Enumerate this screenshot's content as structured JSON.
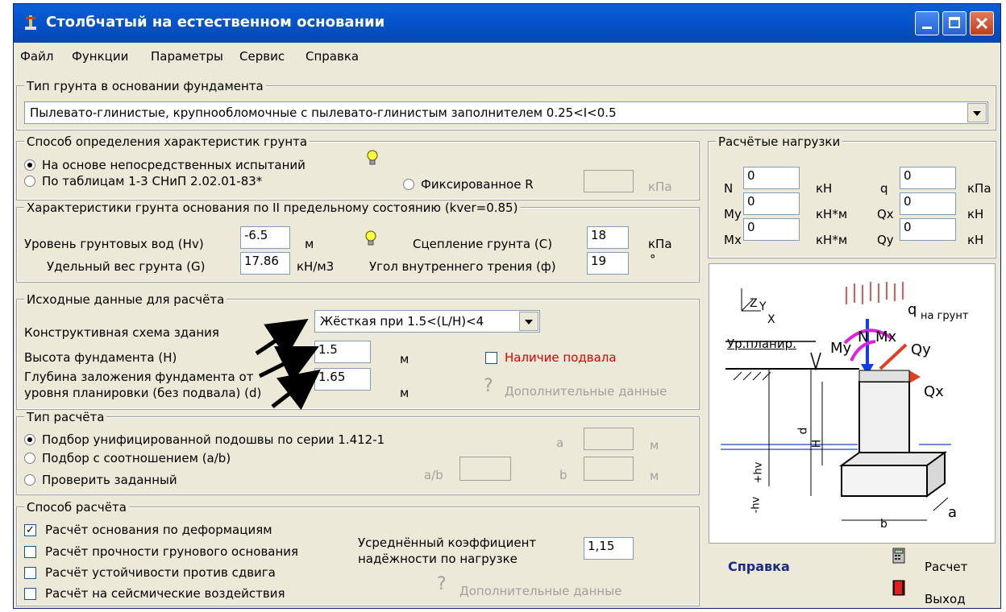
{
  "window": {
    "title": "Столбчатый на естественном основании"
  },
  "menu": [
    "Файл",
    "Функции",
    "Параметры",
    "Сервис",
    "Справка"
  ],
  "soil_type": {
    "legend": "Тип грунта в основании фундамента",
    "value": "Пылевато-глинистые, крупнообломочные с пылевато-глинистым заполнителем  0.25<I<0.5"
  },
  "method": {
    "legend": "Способ определения характеристик грунта",
    "opt1": "На основе непосредственных испытаний",
    "opt2": "По таблицам 1-3 СНиП 2.02.01-83*",
    "opt3": "Фиксированное R",
    "r_value": "",
    "r_unit": "кПа"
  },
  "soil_props": {
    "legend": "Характеристики грунта основания по II предельному состоянию (kver=0.85)",
    "hv_label": "Уровень грунтовых вод (Hv)",
    "hv_value": "-6.5",
    "hv_unit": "м",
    "g_label": "Удельный вес грунта (G)",
    "g_value": "17.86",
    "g_unit": "кН/м3",
    "c_label": "Сцепление грунта (С)",
    "c_value": "18",
    "c_unit": "кПа",
    "phi_label": "Угол внутреннего трения (ф)",
    "phi_value": "19",
    "phi_unit": "°"
  },
  "input": {
    "legend": "Исходные данные для расчёта",
    "scheme_label": "Конструктивная схема здания",
    "scheme_value": "Жёсткая при 1.5<(L/H)<4",
    "h_label": "Высота фундамента (H)",
    "h_value": "1.5",
    "h_unit": "м",
    "d_label1": "Глубина заложения фундамента от",
    "d_label2": "уровня планировки (без подвала) (d)",
    "d_value": "1.65",
    "d_unit": "м",
    "basement": "Наличие подвала",
    "extra": "Дополнительные данные"
  },
  "calc_type": {
    "legend": "Тип расчёта",
    "opt1": "Подбор унифицированной подошвы по серии 1.412-1",
    "opt2": "Подбор с соотношением (a/b)",
    "opt3": "Проверить заданный",
    "ab_label": "a/b",
    "a_label": "a",
    "b_label": "b",
    "unit": "м"
  },
  "calc_method": {
    "legend": "Способ расчёта",
    "c1": "Расчёт основания по деформациям",
    "c2": "Расчёт прочности грунового основания",
    "c3": "Расчёт устойчивости против сдвига",
    "c4": "Расчёт на сейсмические воздействия",
    "coef_label1": "Усреднённый коэффициент",
    "coef_label2": "надёжности по нагрузке",
    "coef_value": "1,15",
    "extra": "Дополнительные данные"
  },
  "loads": {
    "legend": "Расчётые нагрузки",
    "n": {
      "label": "N",
      "value": "0",
      "unit": "кН"
    },
    "my": {
      "label": "My",
      "value": "0",
      "unit": "кН*м"
    },
    "mx": {
      "label": "Mx",
      "value": "0",
      "unit": "кН*м"
    },
    "q": {
      "label": "q",
      "value": "0",
      "unit": "кПа"
    },
    "qx": {
      "label": "Qx",
      "value": "0",
      "unit": "кН"
    },
    "qy": {
      "label": "Qy",
      "value": "0",
      "unit": "кН"
    }
  },
  "diagram": {
    "plan_label": "Ур.планир.",
    "q_label": "q",
    "ground_label": "на грунт",
    "n": "N",
    "mx": "Mx",
    "my": "My",
    "qy": "Qy",
    "qx": "Qx",
    "z": "Z",
    "y": "Y",
    "x": "X",
    "d": "d",
    "h": "H",
    "hv_pos": "+hv",
    "hv_neg": "-hv",
    "b": "b",
    "a": "a"
  },
  "footer": {
    "help": "Справка",
    "calc": "Расчет",
    "exit": "Выход"
  }
}
